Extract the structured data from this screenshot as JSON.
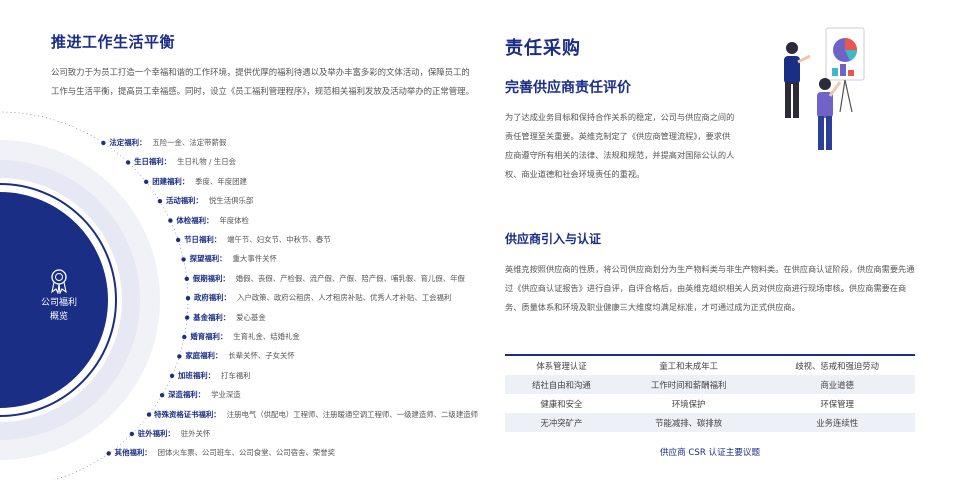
{
  "left": {
    "title": "推进工作生活平衡",
    "intro": "公司致力于为员工打造一个幸福和谐的工作环境，提供优厚的福利待遇以及举办丰富多彩的文体活动，保障员工的工作与生活平衡，提高员工幸福感。同时，设立《员工福利管理程序》，规范相关福利发放及活动举办的正常管理。",
    "circle_label_line1": "公司福利",
    "circle_label_line2": "概览",
    "circle_icon": "award-ribbon-icon",
    "welfare": [
      {
        "name": "法定福利：",
        "value": "五险一金、法定带薪假"
      },
      {
        "name": "生日福利：",
        "value": "生日礼物 / 生日会"
      },
      {
        "name": "团建福利：",
        "value": "季度、年度团建"
      },
      {
        "name": "活动福利：",
        "value": "悦生活俱乐部"
      },
      {
        "name": "体检福利：",
        "value": "年度体检"
      },
      {
        "name": "节日福利：",
        "value": "端午节、妇女节、中秋节、春节"
      },
      {
        "name": "探望福利：",
        "value": "重大事件关怀"
      },
      {
        "name": "假期福利：",
        "value": "婚假、丧假、产检假、流产假、产假、陪产假、哺乳假、育儿假、年假"
      },
      {
        "name": "政府福利：",
        "value": "入户政策、政府公租房、人才租房补贴、优秀人才补贴、工会福利"
      },
      {
        "name": "基金福利：",
        "value": "爱心基金"
      },
      {
        "name": "婚育福利：",
        "value": "生育礼金、结婚礼金"
      },
      {
        "name": "家庭福利：",
        "value": "长辈关怀、子女关怀"
      },
      {
        "name": "加班福利：",
        "value": "打车福利"
      },
      {
        "name": "深造福利：",
        "value": "学业深造"
      },
      {
        "name": "特殊资格证书福利：",
        "value": "注册电气（供配电）工程师、注册暖通空调工程师、一级建造师、二级建造师"
      },
      {
        "name": "驻外福利：",
        "value": "驻外关怀"
      },
      {
        "name": "其他福利：",
        "value": "团体火车票、公司班车、公司食堂、公司宿舍、荣誉奖"
      }
    ],
    "colors": {
      "navy": "#1b2e86",
      "ring_light": "#e6e8f3"
    }
  },
  "right": {
    "title": "责任采购",
    "subtitle": "完善供应商责任评价",
    "p1": "为了达成业务目标和保持合作关系的稳定，公司与供应商之间的责任管理至关重要。英维克制定了《供应商管理流程》，要求供应商遵守所有相关的法律、法规和规范，并提高对国际公认的人权、商业道德和社会环境责任的重视。",
    "subtitle2": "供应商引入与认证",
    "p2": "英维克按照供应商的性质，将公司供应商划分为生产物料类与非生产物料类。在供应商认证阶段，供应商需要先通过《供应商认证报告》进行自评，自评合格后，由英维克组织相关人员对供应商进行现场审核。供应商需要在商务、质量体系和环境及职业健康三大维度均满足标准，才可通过成为正式供应商。",
    "illustration": "business-presentation-illustration",
    "table_rows": [
      [
        "体系管理认证",
        "童工和未成年工",
        "歧视、惩戒和强迫劳动"
      ],
      [
        "结社自由和沟通",
        "工作时间和薪酬福利",
        "商业道德"
      ],
      [
        "健康和安全",
        "环境保护",
        "环保管理"
      ],
      [
        "无冲突矿产",
        "节能减排、碳排放",
        "业务连续性"
      ]
    ],
    "table_caption": "供应商 CSR 认证主要议题"
  }
}
